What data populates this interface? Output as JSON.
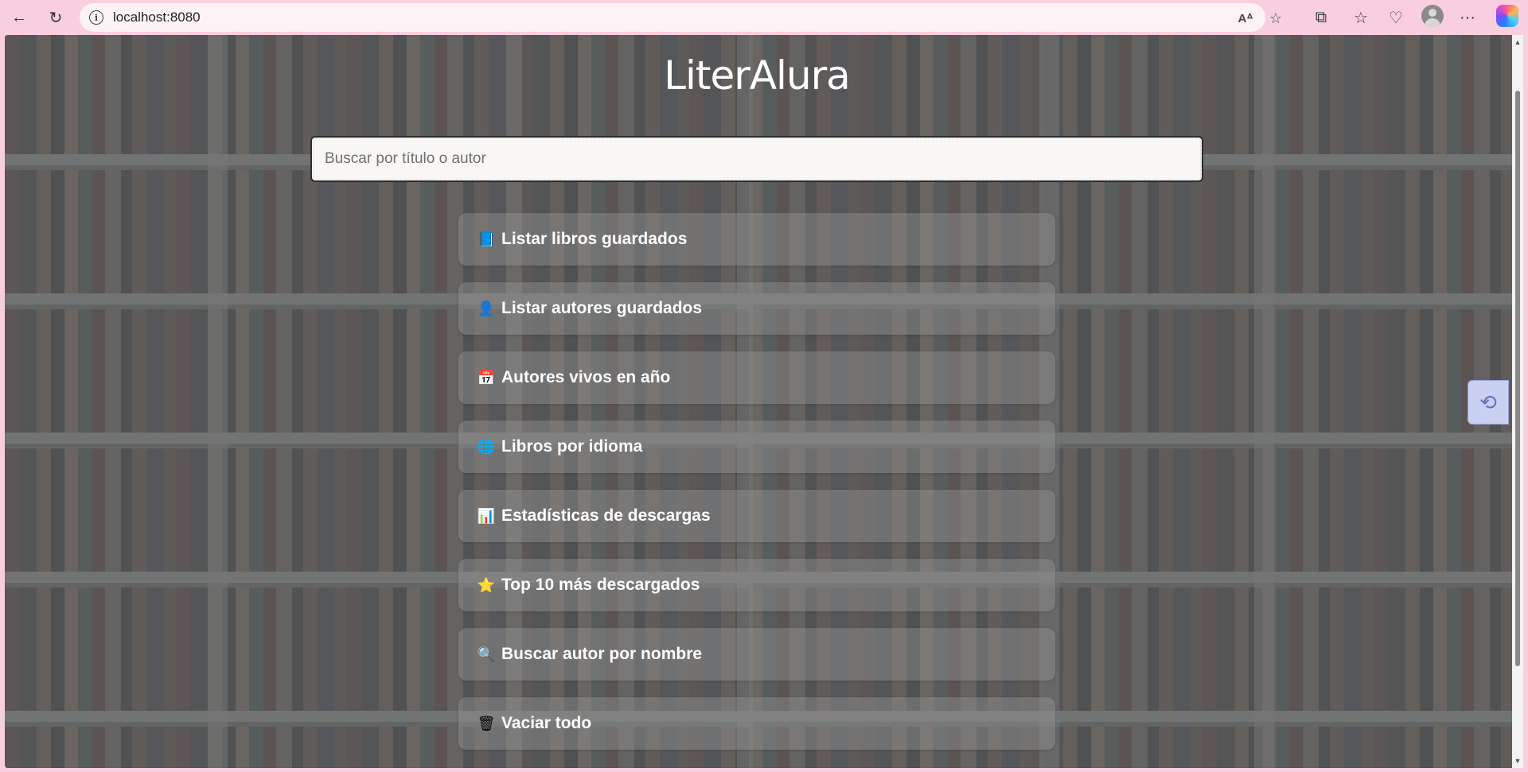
{
  "browser": {
    "url": "localhost:8080",
    "back_icon": "arrow-left-icon",
    "refresh_icon": "refresh-icon",
    "info_icon": "info-icon",
    "read_aloud_icon": "read-aloud-icon",
    "favorite_icon": "star-icon",
    "extensions_icon": "extensions-icon",
    "favorites_icon": "favorites-icon",
    "health_icon": "heart-pulse-icon",
    "profile_icon": "profile-avatar",
    "more_icon": "more-icon",
    "copilot_icon": "copilot-icon"
  },
  "app": {
    "title": "LiterAlura",
    "search_placeholder": "Buscar por título o autor",
    "menu": [
      {
        "icon": "📘",
        "label": "Listar libros guardados"
      },
      {
        "icon": "👤",
        "label": "Listar autores guardados"
      },
      {
        "icon": "📅",
        "label": "Autores vivos en año"
      },
      {
        "icon": "🌐",
        "label": "Libros por idioma"
      },
      {
        "icon": "📊",
        "label": "Estadísticas de descargas"
      },
      {
        "icon": "⭐",
        "label": "Top 10 más descargados"
      },
      {
        "icon": "🔍",
        "label": "Buscar autor por nombre"
      },
      {
        "icon": "🗑",
        "label": "Vaciar todo"
      }
    ]
  }
}
